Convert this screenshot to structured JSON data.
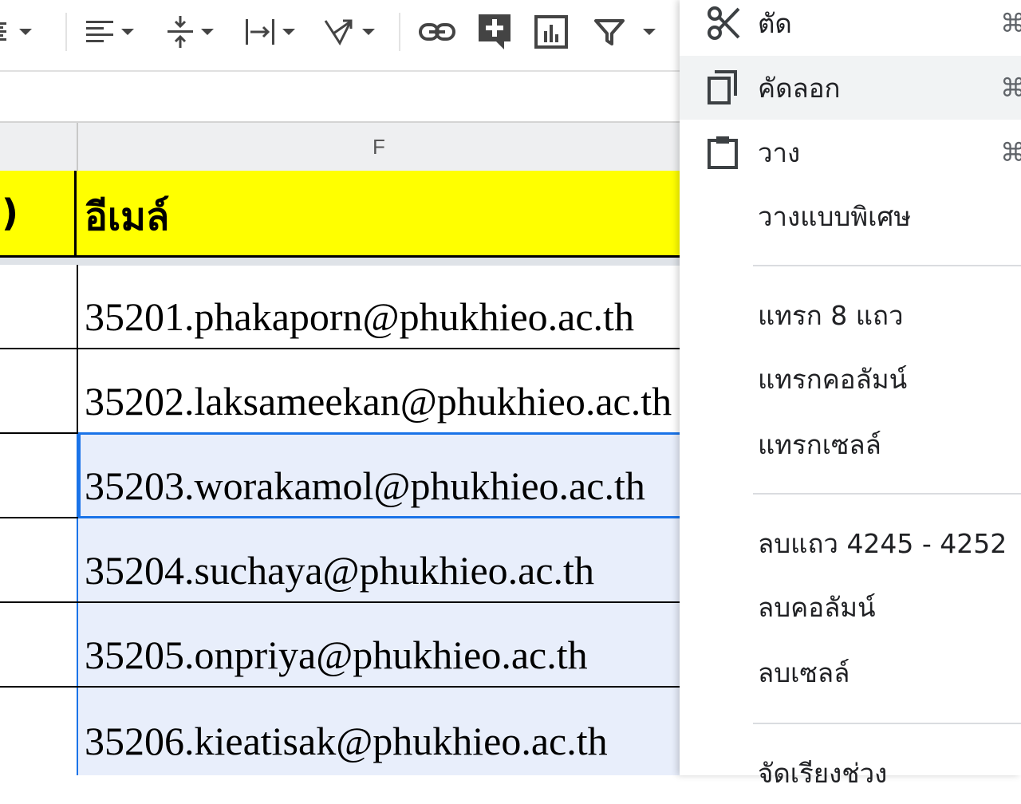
{
  "toolbar": {
    "items": [
      {
        "name": "wrap-menu",
        "icon": "text-wrap-icon"
      },
      {
        "name": "horizontal-align-menu",
        "icon": "align-left-icon"
      },
      {
        "name": "vertical-align-menu",
        "icon": "vertical-align-icon"
      },
      {
        "name": "text-wrapping-menu",
        "icon": "text-wrapping-icon"
      },
      {
        "name": "text-rotation-menu",
        "icon": "text-rotation-icon"
      },
      {
        "name": "insert-link",
        "icon": "link-icon"
      },
      {
        "name": "insert-comment",
        "icon": "add-comment-icon"
      },
      {
        "name": "insert-chart",
        "icon": "chart-icon"
      },
      {
        "name": "filter-menu",
        "icon": "filter-icon"
      }
    ]
  },
  "sheet": {
    "column_label": "F",
    "prev_header_fragment": "ม)",
    "header": "อีเมล์",
    "rows": [
      {
        "email": "35201.phakaporn@phukhieo.ac.th",
        "selected": false
      },
      {
        "email": "35202.laksameekan@phukhieo.ac.th",
        "selected": false
      },
      {
        "email": "35203.worakamol@phukhieo.ac.th",
        "selected": true,
        "active": true
      },
      {
        "email": "35204.suchaya@phukhieo.ac.th",
        "selected": true
      },
      {
        "email": "35205.onpriya@phukhieo.ac.th",
        "selected": true
      },
      {
        "email": "35206.kieatisak@phukhieo.ac.th",
        "selected": true
      }
    ],
    "colors": {
      "header_fill": "#ffff00",
      "selection_fill": "#e8eefb",
      "selection_border": "#1a73e8"
    }
  },
  "context_menu": {
    "cut": "ตัด",
    "copy": "คัดลอก",
    "paste": "วาง",
    "paste_special": "วางแบบพิเศษ",
    "insert_rows": "แทรก 8 แถว",
    "insert_column": "แทรกคอลัมน์",
    "insert_cells": "แทรกเซลล์",
    "delete_rows": "ลบแถว 4245 - 4252",
    "delete_column": "ลบคอลัมน์",
    "delete_cells": "ลบเซลล์",
    "sort_range": "จัดเรียงช่วง",
    "shortcut_fragment": "⌘"
  }
}
